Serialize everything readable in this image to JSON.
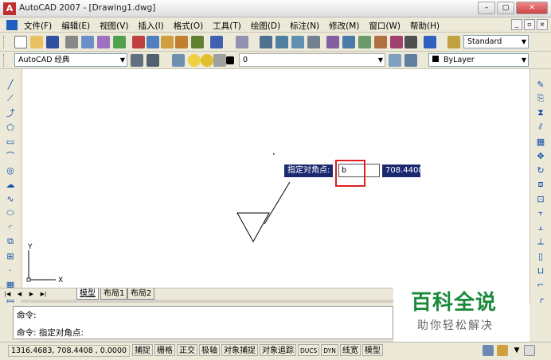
{
  "window": {
    "title": "AutoCAD 2007 - [Drawing1.dwg]"
  },
  "menu": {
    "items": [
      "文件(F)",
      "编辑(E)",
      "视图(V)",
      "插入(I)",
      "格式(O)",
      "工具(T)",
      "绘图(D)",
      "标注(N)",
      "修改(M)",
      "窗口(W)",
      "帮助(H)"
    ]
  },
  "toolbar": {
    "text_style": "Standard",
    "workspace": "AutoCAD 经典",
    "layer": "0",
    "color": "ByLayer"
  },
  "dynamic_input": {
    "prompt": "指定对角点:",
    "value": "b",
    "coordinate": "708.4408"
  },
  "ucs": {
    "y_label": "Y",
    "x_label": "X"
  },
  "layout_tabs": [
    "模型",
    "布局1",
    "布局2"
  ],
  "command": {
    "line1": "命令:",
    "line2": "命令: 指定对角点:"
  },
  "status": {
    "coords": "1316.4683,  708.4408 ,  0.0000",
    "toggles": [
      "捕捉",
      "栅格",
      "正交",
      "极轴",
      "对象捕捉",
      "对象追踪",
      "DUCS",
      "DYN",
      "线宽",
      "模型"
    ]
  },
  "watermark": {
    "title": "百科全说",
    "subtitle": "助你轻松解决"
  },
  "colors": {
    "accent_navy": "#1b2a70",
    "highlight_red": "#e02020",
    "watermark_green": "#1a8a3a"
  }
}
